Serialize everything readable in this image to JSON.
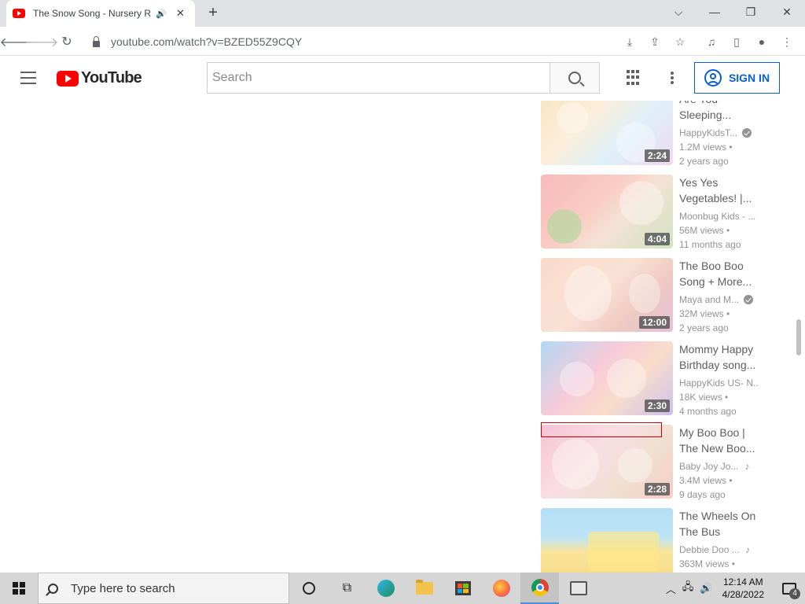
{
  "browser": {
    "tab_title": "The Snow Song - Nursery Rhymes",
    "tab_close": "✕",
    "new_tab": "+",
    "url": "youtube.com/watch?v=BZED55Z9CQY",
    "window_controls": {
      "dropdown": "⌵",
      "minimize": "—",
      "restore": "❐",
      "close": "✕"
    }
  },
  "youtube": {
    "logo_text": "YouTube",
    "search_placeholder": "Search",
    "sign_in_label": "SIGN IN"
  },
  "recommendations": [
    {
      "title": "Are You Sleeping...",
      "channel": "HappyKidsT...",
      "verified": true,
      "views": "1.2M views •",
      "age": "2 years ago",
      "duration": "2:24"
    },
    {
      "title": "Yes Yes Vegetables! |...",
      "channel": "Moonbug Kids - ...",
      "verified": false,
      "views": "56M views •",
      "age": "11 months ago",
      "duration": "4:04"
    },
    {
      "title": "The Boo Boo Song + More...",
      "channel": "Maya and M...",
      "verified": true,
      "views": "32M views •",
      "age": "2 years ago",
      "duration": "12:00"
    },
    {
      "title": "Mommy Happy Birthday song...",
      "channel": "HappyKids US- N...",
      "verified": false,
      "views": "18K views •",
      "age": "4 months ago",
      "duration": "2:30"
    },
    {
      "title": "My Boo Boo | The New Boo...",
      "channel": "Baby Joy Jo...",
      "verified": false,
      "music": true,
      "views": "3.4M views •",
      "age": "9 days ago",
      "duration": "2:28"
    },
    {
      "title": "The Wheels On The Bus Song...",
      "channel": "Debbie Doo ...",
      "verified": false,
      "music": true,
      "views": "363M views •",
      "age": "",
      "duration": ""
    }
  ],
  "taskbar": {
    "search_placeholder": "Type here to search",
    "time": "12:14 AM",
    "date": "4/28/2022",
    "notification_count": "4"
  }
}
